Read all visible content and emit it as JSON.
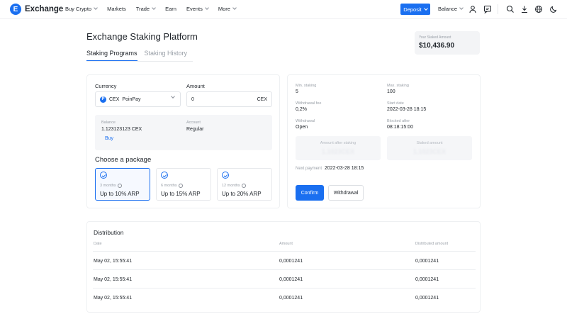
{
  "header": {
    "logo_letter": "E",
    "brand": "Exchange",
    "nav": [
      "Buy Crypto",
      "Markets",
      "Trade",
      "Earn",
      "Events",
      "More"
    ],
    "deposit_label": "Deposit",
    "balance_label": "Balance",
    "icons": [
      "user-icon",
      "chat-icon",
      "search-icon",
      "download-icon",
      "globe-icon",
      "moon-icon"
    ],
    "accent_color": "#1a6ff0"
  },
  "page": {
    "title": "Exchange Staking Platform",
    "tabs": [
      "Staking Programs",
      "Staking History"
    ],
    "active_tab": "Staking Programs",
    "staked_label": "Your Staked Amount",
    "staked_value": "$10,436.90"
  },
  "stake_form": {
    "currency_label": "Currency",
    "currency_symbol": "CEX",
    "currency_name": "PoinPay",
    "coin_letter": "P",
    "amount_label": "Amount",
    "amount_value": "0",
    "amount_unit": "CEX",
    "balance_label": "Balance",
    "balance_value": "1.123123123 CEX",
    "buy_label": "Buy",
    "account_label": "Account",
    "account_value": "Regular",
    "package_title": "Choose a package",
    "packages": [
      {
        "months": "3 months",
        "rate": "Up to 10% ARP",
        "selected": true
      },
      {
        "months": "6 months",
        "rate": "Up to 15% ARP",
        "selected": false
      },
      {
        "months": "12 months",
        "rate": "Up to 20% ARP",
        "selected": false
      }
    ]
  },
  "summary": {
    "min_staking_label": "Min. staking",
    "min_staking": "5",
    "max_staking_label": "Max. staking",
    "max_staking": "100",
    "withdrawal_fee_label": "Withdrawal fee",
    "withdrawal_fee": "0,2%",
    "start_date_label": "Start date",
    "start_date": "2022-03-28 18:15",
    "withdrawal_label": "Withdrawal",
    "withdrawal": "Open",
    "blocked_label": "Blocked after",
    "blocked": "08:18:15:00",
    "amount_after_label": "Amount after staking",
    "amount_after_value": "1.1023CEX",
    "staked_amount_label": "Staked amount",
    "staked_amount_value": "1.1023CEX",
    "next_payment_label": "Next payment",
    "next_payment": "2022-03-28 18:15",
    "confirm_label": "Confirm",
    "withdrawal_button": "Withdrawal"
  },
  "distribution": {
    "title": "Distribution",
    "columns": [
      "Date",
      "Amount",
      "Distributed amount"
    ],
    "rows": [
      {
        "date": "May 02, 15:55:41",
        "amount": "0,0001241",
        "distributed": "0,0001241"
      },
      {
        "date": "May 02, 15:55:41",
        "amount": "0,0001241",
        "distributed": "0,0001241"
      },
      {
        "date": "May 02, 15:55:41",
        "amount": "0,0001241",
        "distributed": "0,0001241"
      }
    ]
  }
}
